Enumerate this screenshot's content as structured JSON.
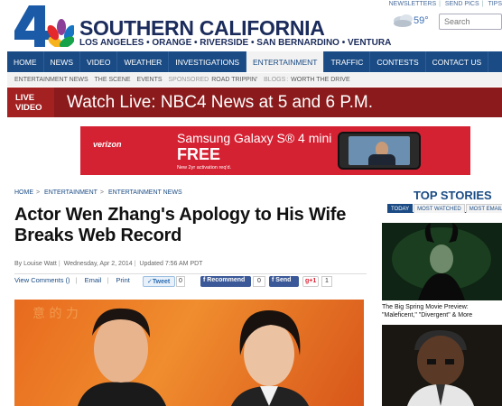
{
  "header": {
    "brand": "SOUTHERN CALIFORNIA",
    "regions": "LOS ANGELES • ORANGE • RIVERSIDE • SAN BERNARDINO • VENTURA",
    "logo_number": "4",
    "top_links": [
      "NEWSLETTERS",
      "SEND PICS",
      "TIPS"
    ],
    "temperature": "59°",
    "search_placeholder": "Search"
  },
  "nav": {
    "items": [
      "HOME",
      "NEWS",
      "VIDEO",
      "WEATHER",
      "INVESTIGATIONS",
      "ENTERTAINMENT",
      "TRAFFIC",
      "CONTESTS",
      "CONTACT US"
    ],
    "active": "ENTERTAINMENT"
  },
  "subnav": {
    "items": [
      "ENTERTAINMENT NEWS",
      "THE SCENE",
      "EVENTS"
    ],
    "sponsored_label": "SPONSORED",
    "sponsored_item": "ROAD TRIPPIN'",
    "blogs_label": "BLOGS",
    "blogs_item": "WORTH THE DRIVE"
  },
  "live_banner": {
    "tag_line1": "LIVE",
    "tag_line2": "VIDEO",
    "text": "Watch Live: NBC4 News at 5 and 6 P.M."
  },
  "ad": {
    "advertiser": "verizon",
    "headline": "Samsung Galaxy S® 4 mini",
    "offer": "FREE",
    "fine_print": "New 2yr activation req'd.",
    "brand_color": "#d52233"
  },
  "article": {
    "breadcrumb": [
      "HOME",
      "ENTERTAINMENT",
      "ENTERTAINMENT NEWS"
    ],
    "headline": "Actor Wen Zhang's Apology to His Wife Breaks Web Record",
    "byline_author": "By Louise Watt",
    "byline_date": "Wednesday, Apr 2, 2014",
    "byline_updated": "Updated 7:56 AM PDT",
    "view_comments": "View Comments ()",
    "email": "Email",
    "print": "Print",
    "tweet_label": "Tweet",
    "tweet_count": "0",
    "recommend_label": "Recommend",
    "recommend_count": "0",
    "send_label": "Send",
    "gplus_label": "g+1",
    "gplus_count": "1"
  },
  "sidebar": {
    "title": "TOP STORIES",
    "tabs": [
      "TODAY",
      "MOST WATCHED",
      "MOST EMAILED"
    ],
    "active_tab": "TODAY",
    "story1_caption": "The Big Spring Movie Preview: \"Maleficent,\" \"Divergent\" & More"
  },
  "colors": {
    "nav_blue": "#1a4b84",
    "live_red": "#8a1a1b",
    "brand_navy": "#1b2c5c"
  }
}
